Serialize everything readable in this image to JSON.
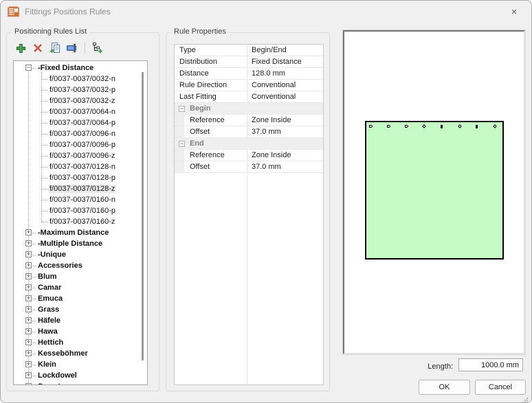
{
  "window": {
    "title": "Fittings Positions Rules",
    "close_glyph": "×"
  },
  "rules_list": {
    "group_title": "Positioning Rules List",
    "toolbar": [
      {
        "name": "add-rule",
        "icon": "plus-icon"
      },
      {
        "name": "delete-rule",
        "icon": "delete-x-icon"
      },
      {
        "name": "copy-rule",
        "icon": "copy-pages-icon"
      },
      {
        "name": "rename-rule",
        "icon": "rename-ibeam-icon"
      },
      {
        "name": "add-category",
        "icon": "tree-add-icon"
      }
    ],
    "tree": {
      "selected": "f/0037-0037/0128-z",
      "roots": [
        {
          "label": "-Fixed Distance",
          "expanded": true,
          "children": [
            "f/0037-0037/0032-n",
            "f/0037-0037/0032-p",
            "f/0037-0037/0032-z",
            "f/0037-0037/0064-n",
            "f/0037-0037/0064-p",
            "f/0037-0037/0096-n",
            "f/0037-0037/0096-p",
            "f/0037-0037/0096-z",
            "f/0037-0037/0128-n",
            "f/0037-0037/0128-p",
            "f/0037-0037/0128-z",
            "f/0037-0037/0160-n",
            "f/0037-0037/0160-p",
            "f/0037-0037/0160-z"
          ]
        },
        {
          "label": "-Maximum Distance",
          "expanded": false
        },
        {
          "label": "-Multiple Distance",
          "expanded": false
        },
        {
          "label": "-Unique",
          "expanded": false
        },
        {
          "label": "Accessories",
          "expanded": false
        },
        {
          "label": "Blum",
          "expanded": false
        },
        {
          "label": "Camar",
          "expanded": false
        },
        {
          "label": "Emuca",
          "expanded": false
        },
        {
          "label": "Grass",
          "expanded": false
        },
        {
          "label": "Häfele",
          "expanded": false
        },
        {
          "label": "Hawa",
          "expanded": false
        },
        {
          "label": "Hettich",
          "expanded": false
        },
        {
          "label": "Kesseböhmer",
          "expanded": false
        },
        {
          "label": "Klein",
          "expanded": false
        },
        {
          "label": "Lockdowel",
          "expanded": false
        },
        {
          "label": "Samet",
          "expanded": false
        }
      ]
    }
  },
  "rule_properties": {
    "group_title": "Rule Properties",
    "rows": [
      {
        "kind": "top",
        "label": "Type",
        "value": "Begin/End"
      },
      {
        "kind": "top",
        "label": "Distribution",
        "value": "Fixed Distance"
      },
      {
        "kind": "top",
        "label": "Distance",
        "value": "128.0 mm"
      },
      {
        "kind": "top",
        "label": "Rule Direction",
        "value": "Conventional"
      },
      {
        "kind": "top",
        "label": "Last Fitting",
        "value": "Conventional"
      },
      {
        "kind": "group",
        "label": "Begin",
        "value": ""
      },
      {
        "kind": "child",
        "label": "Reference",
        "value": "Zone Inside"
      },
      {
        "kind": "child",
        "label": "Offset",
        "value": "37.0 mm"
      },
      {
        "kind": "group",
        "label": "End",
        "value": ""
      },
      {
        "kind": "child",
        "label": "Reference",
        "value": "Zone Inside"
      },
      {
        "kind": "child",
        "label": "Offset",
        "value": "37.0 mm"
      }
    ]
  },
  "preview": {
    "zone_fill": "#c6fbc6",
    "zone_border": "#000000",
    "marks": [
      {
        "shape": "flag"
      },
      {
        "shape": "flag"
      },
      {
        "shape": "flag"
      },
      {
        "shape": "diamond"
      },
      {
        "shape": "bar"
      },
      {
        "shape": "diamond"
      },
      {
        "shape": "bar"
      },
      {
        "shape": "diamond"
      }
    ]
  },
  "footer": {
    "length_label": "Length:",
    "length_value": "1000.0 mm",
    "ok_label": "OK",
    "cancel_label": "Cancel"
  },
  "colors": {
    "dialog_bg": "#f0f0f0",
    "add_green": "#3f9e45",
    "delete_red": "#c4502e",
    "rename_blue": "#4f86d2",
    "title_icon_orange": "#c8622c"
  }
}
